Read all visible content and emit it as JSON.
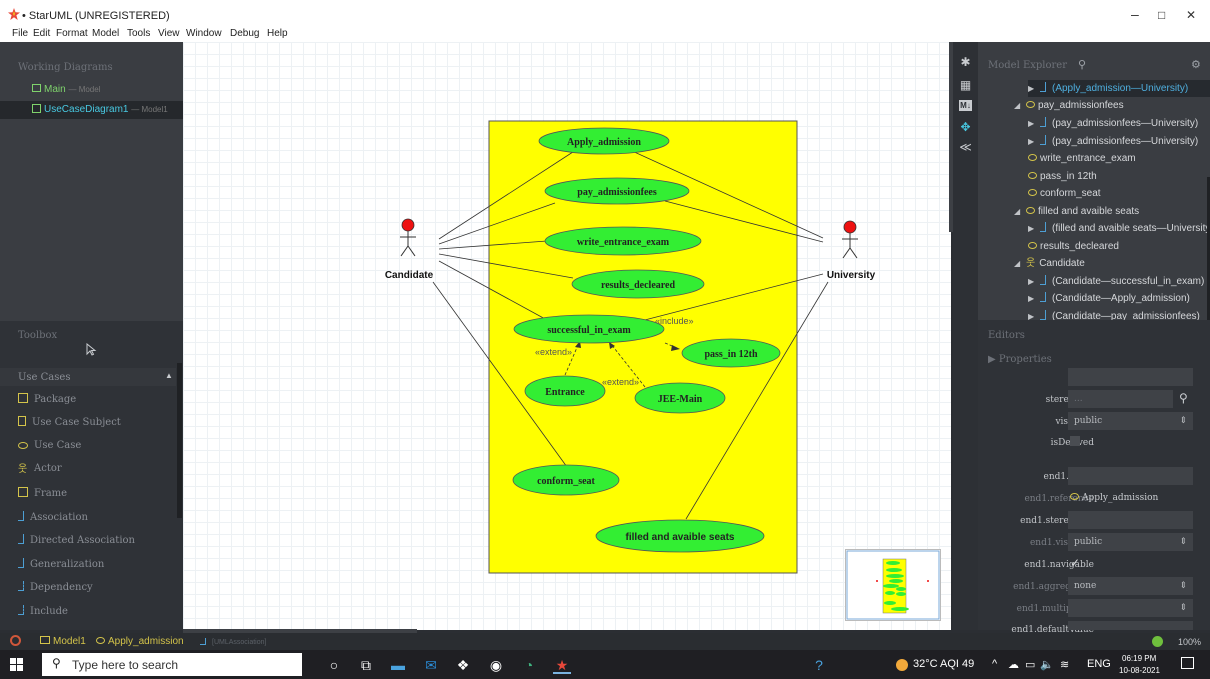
{
  "window": {
    "title": "• StarUML (UNREGISTERED)",
    "minimize": "–",
    "maximize": "□",
    "close": "✕"
  },
  "menu": [
    "File",
    "Edit",
    "Format",
    "Model",
    "Tools",
    "View",
    "Window",
    "Debug",
    "Help"
  ],
  "working_diagrams": {
    "header": "Working Diagrams",
    "items": [
      {
        "name": "Main",
        "sub": "— Model"
      },
      {
        "name": "UseCaseDiagram1",
        "sub": "— Model1"
      }
    ]
  },
  "toolbox": {
    "header": "Toolbox",
    "section": "Use Cases",
    "items": [
      "Package",
      "Use Case Subject",
      "Use Case",
      "Actor",
      "Frame",
      "Association",
      "Directed Association",
      "Generalization",
      "Dependency",
      "Include"
    ]
  },
  "diagram": {
    "actors": [
      "Candidate",
      "University"
    ],
    "use_cases": [
      "Apply_admission",
      "pay_admissionfees",
      "write_entrance_exam",
      "results_decleared",
      "successful_in_exam",
      "pass_in 12th",
      "Entrance",
      "JEE-Main",
      "conform_seat",
      "filled and avaible seats"
    ],
    "stereotypes": {
      "include": "«include»",
      "extend1": "«extend»",
      "extend2": "«extend»"
    }
  },
  "model_explorer": {
    "header": "Model Explorer",
    "items": [
      "(Apply_admission—University)",
      "pay_admissionfees",
      "(pay_admissionfees—University)",
      "(pay_admissionfees—University)",
      "write_entrance_exam",
      "pass_in 12th",
      "conform_seat",
      "filled and avaible seats",
      "(filled and avaible seats—University",
      "results_decleared",
      "Candidate",
      "(Candidate—successful_in_exam)",
      "(Candidate—Apply_admission)",
      "(Candidate—pay_admissionfees)"
    ]
  },
  "editors": {
    "header": "Editors",
    "properties_label": "Properties",
    "rows": [
      {
        "label": "name",
        "value": ""
      },
      {
        "label": "stereotype",
        "value": "..."
      },
      {
        "label": "visibility",
        "value": "public"
      },
      {
        "label": "isDerived",
        "value": ""
      },
      {
        "label": "end1.name",
        "value": ""
      },
      {
        "label": "end1.reference",
        "value": "Apply_admission"
      },
      {
        "label": "end1.stereotype",
        "value": ""
      },
      {
        "label": "end1.visibility",
        "value": "public"
      },
      {
        "label": "end1.navigable",
        "value": "✓"
      },
      {
        "label": "end1.aggregation",
        "value": "none"
      },
      {
        "label": "end1.multiplicity",
        "value": ""
      },
      {
        "label": "end1.defaultValue",
        "value": ""
      }
    ]
  },
  "statusbar": {
    "model": "Model1",
    "element": "Apply_admission",
    "type": "[UMLAssociation]",
    "zoom": "100%"
  },
  "taskbar": {
    "search_placeholder": "Type here to search",
    "weather": "32°C AQI 49",
    "lang": "ENG",
    "time": "06:19 PM",
    "date": "10-08-2021"
  },
  "colors": {
    "subject_fill": "#ffff00",
    "usecase_fill": "#33ee33",
    "actor_head": "#ee1111",
    "accent": "#48c9e2"
  }
}
